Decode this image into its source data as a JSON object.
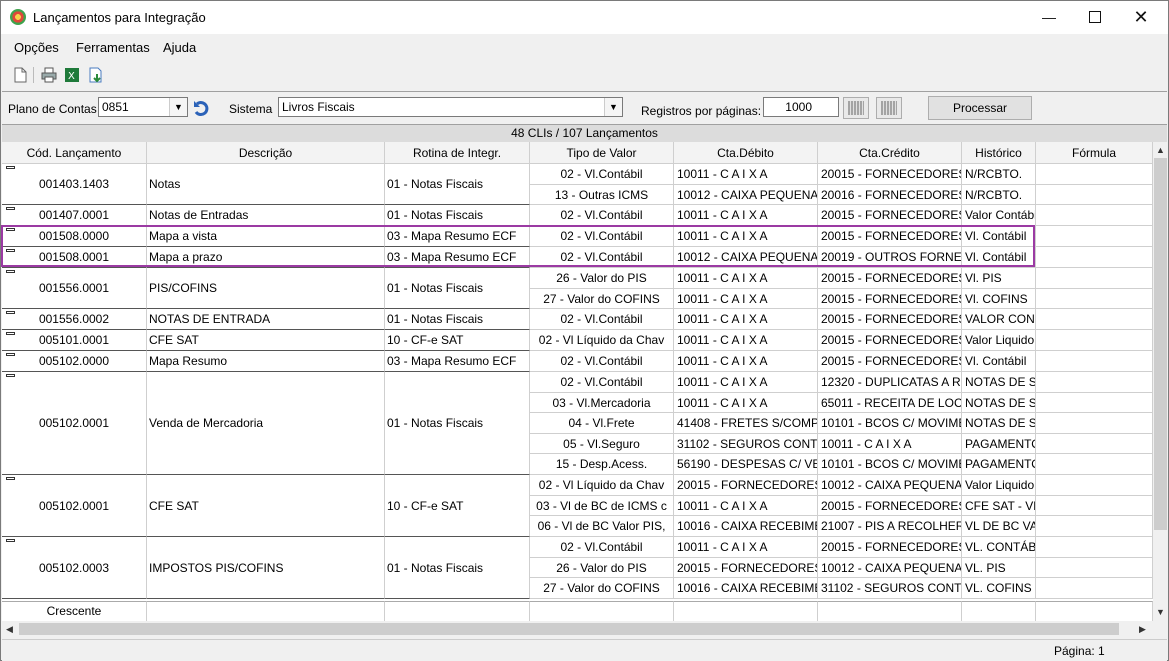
{
  "window": {
    "title": "Lançamentos para Integração"
  },
  "menu": [
    "Opções",
    "Ferramentas",
    "Ajuda"
  ],
  "filter": {
    "plano_label": "Plano de Contas",
    "plano_value": "0851",
    "sistema_label": "Sistema",
    "sistema_value": "Livros Fiscais",
    "registros_label": "Registros por páginas:",
    "registros_value": "1000",
    "processar_label": "Processar"
  },
  "summary": "48 CLIs / 107 Lançamentos",
  "columns": [
    "Cód. Lançamento",
    "Descrição",
    "Rotina de Integr.",
    "Tipo de Valor",
    "Cta.Débito",
    "Cta.Crédito",
    "Histórico",
    "Fórmula"
  ],
  "groups": [
    {
      "code": "001403.1403",
      "desc": "Notas",
      "rotina": "01 - Notas Fiscais",
      "rows": [
        [
          "02 - Vl.Contábil",
          "10011 - C A I X A",
          "20015 - FORNECEDORES",
          "N/RCBTO."
        ],
        [
          "13 - Outras ICMS",
          "10012 - CAIXA PEQUENA",
          "20016 - FORNECEDORES/I",
          "N/RCBTO."
        ]
      ]
    },
    {
      "code": "001407.0001",
      "desc": "Notas de Entradas",
      "rotina": "01 - Notas Fiscais",
      "rows": [
        [
          "02 - Vl.Contábil",
          "10011 - C A I X A",
          "20015 - FORNECEDORES",
          "Valor Contábi"
        ]
      ]
    },
    {
      "code": "001508.0000",
      "desc": "Mapa a vista",
      "rotina": "03 - Mapa Resumo ECF",
      "rows": [
        [
          "02 - Vl.Contábil",
          "10011 - C A I X A",
          "20015 - FORNECEDORES",
          "Vl. Contábil"
        ]
      ]
    },
    {
      "code": "001508.0001",
      "desc": "Mapa a prazo",
      "rotina": "03 - Mapa Resumo ECF",
      "rows": [
        [
          "02 - Vl.Contábil",
          "10012 - CAIXA PEQUENA",
          "20019 - OUTROS FORNECE",
          "Vl. Contábil"
        ]
      ]
    },
    {
      "code": "001556.0001",
      "desc": "PIS/COFINS",
      "rotina": "01 - Notas Fiscais",
      "rows": [
        [
          "26 - Valor do PIS",
          "10011 - C A I X A",
          "20015 - FORNECEDORES",
          "Vl. PIS"
        ],
        [
          "27 - Valor do COFINS",
          "10011 - C A I X A",
          "20015 - FORNECEDORES",
          "Vl. COFINS"
        ]
      ]
    },
    {
      "code": "001556.0002",
      "desc": "NOTAS DE ENTRADA",
      "rotina": "01 - Notas Fiscais",
      "rows": [
        [
          "02 - Vl.Contábil",
          "10011 - C A I X A",
          "20015 - FORNECEDORES",
          "VALOR CONT"
        ]
      ]
    },
    {
      "code": "005101.0001",
      "desc": "CFE SAT",
      "rotina": "10 - CF-e SAT",
      "rows": [
        [
          "02 - Vl Líquido da Chav",
          "10011 - C A I X A",
          "20015 - FORNECEDORES",
          "Valor Liquido"
        ]
      ]
    },
    {
      "code": "005102.0000",
      "desc": "Mapa Resumo",
      "rotina": "03 - Mapa Resumo ECF",
      "rows": [
        [
          "02 - Vl.Contábil",
          "10011 - C A I X A",
          "20015 - FORNECEDORES",
          "Vl. Contábil"
        ]
      ]
    },
    {
      "code": "005102.0001",
      "desc": "Venda de Mercadoria",
      "rotina": "01 - Notas Fiscais",
      "rows": [
        [
          "02 - Vl.Contábil",
          "10011 - C A I X A",
          "12320 - DUPLICATAS A RE",
          "NOTAS DE SA"
        ],
        [
          "03 - Vl.Mercadoria",
          "10011 - C A I X A",
          "65011 - RECEITA DE LOCA",
          "NOTAS DE SA"
        ],
        [
          "04 - Vl.Frete",
          "41408 - FRETES S/COMPRA",
          "10101 - BCOS C/ MOVIMEN",
          "NOTAS DE SA"
        ],
        [
          "05 - Vl.Seguro",
          "31102 - SEGUROS CONTRA",
          "10011 - C A I X A",
          "PAGAMENTOS"
        ],
        [
          "15 - Desp.Acess.",
          "56190 - DESPESAS C/ VEIC",
          "10101 - BCOS C/ MOVIMEN",
          "PAGAMENTOS"
        ]
      ]
    },
    {
      "code": "005102.0001",
      "desc": "CFE SAT",
      "rotina": "10 - CF-e SAT",
      "rows": [
        [
          "02 - Vl Líquido da Chav",
          "20015 - FORNECEDORES",
          "10012 - CAIXA PEQUENA",
          "Valor Liquido"
        ],
        [
          "03 - Vl de BC de ICMS c",
          "10011 - C A I X A",
          "20015 - FORNECEDORES",
          "CFE SAT - VL"
        ],
        [
          "06 - Vl de BC Valor PIS,",
          "10016 - CAIXA RECEBIMEN",
          "21007 - PIS A RECOLHER",
          "VL DE BC VAL"
        ]
      ]
    },
    {
      "code": "005102.0003",
      "desc": "IMPOSTOS PIS/COFINS",
      "rotina": "01 - Notas Fiscais",
      "rows": [
        [
          "02 - Vl.Contábil",
          "10011 - C A I X A",
          "20015 - FORNECEDORES",
          "VL. CONTÁBI"
        ],
        [
          "26 - Valor do PIS",
          "20015 - FORNECEDORES",
          "10012 - CAIXA PEQUENA",
          "VL. PIS"
        ],
        [
          "27 - Valor do COFINS",
          "10016 - CAIXA RECEBIMEN",
          "31102 - SEGUROS CONTRA",
          "VL. COFINS"
        ]
      ]
    }
  ],
  "footer": {
    "sort_label": "Crescente"
  },
  "status": {
    "page_label": "Página: 1"
  },
  "icons": [
    "app-icon",
    "minimize-icon",
    "maximize-icon",
    "close-icon",
    "new-document-icon",
    "print-icon",
    "excel-export-icon",
    "import-icon",
    "refresh-icon",
    "chevron-down-icon",
    "collapse-icon"
  ]
}
